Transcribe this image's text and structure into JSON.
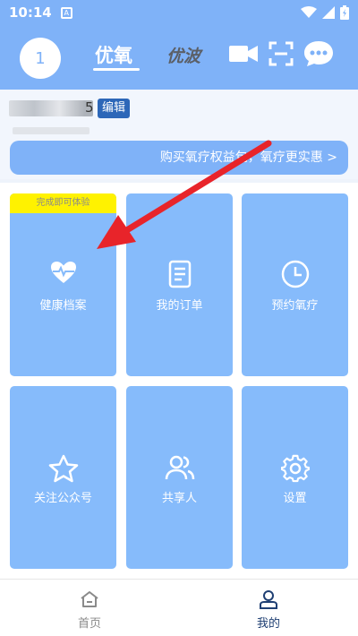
{
  "status_bar": {
    "time": "10:14",
    "app_icon_letter": "A"
  },
  "header": {
    "avatar_text": "1",
    "tab_active": "优氧",
    "tab_inactive": "优波",
    "icons": [
      "video-camera-icon",
      "scan-icon",
      "chat-bubble-icon"
    ]
  },
  "user": {
    "name_suffix": "5",
    "edit_label": "编辑"
  },
  "promo": {
    "text": "购买氧疗权益包，氧疗更实惠 >"
  },
  "tiles": [
    {
      "label": "健康档案",
      "icon": "heart-pulse-icon",
      "badge": "完成即可体验"
    },
    {
      "label": "我的订单",
      "icon": "document-icon"
    },
    {
      "label": "预约氧疗",
      "icon": "clock-icon"
    },
    {
      "label": "关注公众号",
      "icon": "star-icon"
    },
    {
      "label": "共享人",
      "icon": "users-icon"
    },
    {
      "label": "设置",
      "icon": "gear-icon"
    }
  ],
  "nav": {
    "home_label": "首页",
    "mine_label": "我的",
    "active": "我的"
  },
  "colors": {
    "primary": "#7fb2f8",
    "tile": "#86bbfb",
    "edit_button": "#2d67b8",
    "badge": "#fff200",
    "nav_active": "#1f3f73",
    "nav_inactive": "#8a8a8a",
    "annotation_arrow": "#e8242a"
  }
}
